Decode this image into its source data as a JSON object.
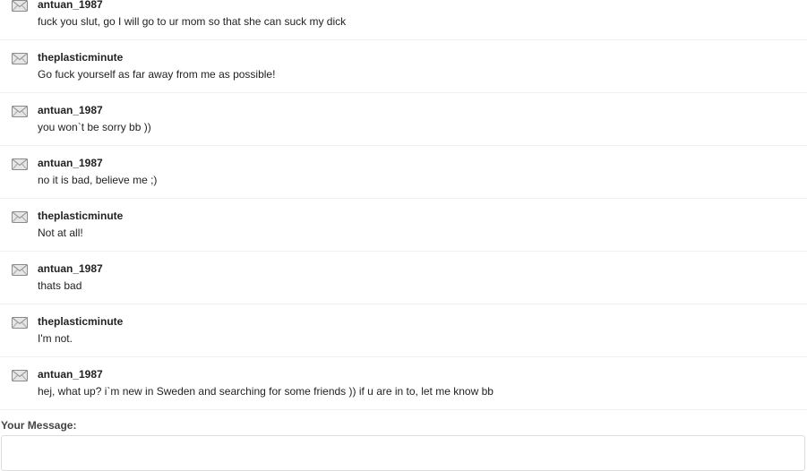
{
  "messages": [
    {
      "sender": "antuan_1987",
      "body": "fuck you slut, go I will go to ur mom so that she can suck my dick"
    },
    {
      "sender": "theplasticminute",
      "body": "Go fuck yourself as far away from me as possible!"
    },
    {
      "sender": "antuan_1987",
      "body": "you won`t be sorry bb ))"
    },
    {
      "sender": "antuan_1987",
      "body": "no it is bad, believe me ;)"
    },
    {
      "sender": "theplasticminute",
      "body": "Not at all!"
    },
    {
      "sender": "antuan_1987",
      "body": "thats bad"
    },
    {
      "sender": "theplasticminute",
      "body": "I'm not."
    },
    {
      "sender": "antuan_1987",
      "body": "hej, what up? i`m new in Sweden and searching for some friends )) if u are in to, let me know bb"
    }
  ],
  "icon": "envelope-icon",
  "compose": {
    "label": "Your Message:",
    "value": ""
  }
}
